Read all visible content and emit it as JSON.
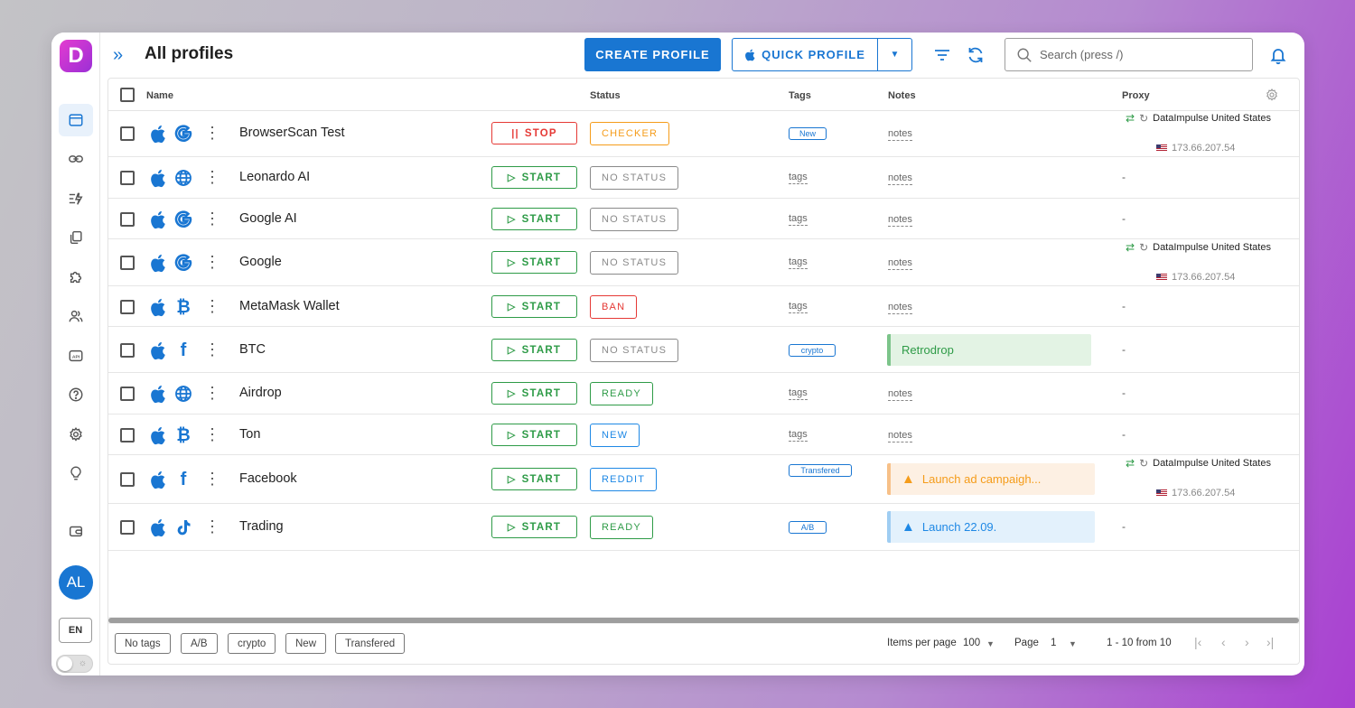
{
  "header": {
    "title": "All profiles",
    "create_label": "CREATE PROFILE",
    "quick_label": "QUICK PROFILE",
    "search_placeholder": "Search (press /)"
  },
  "sidebar": {
    "logo": "D",
    "avatar": "AL",
    "lang": "EN"
  },
  "table": {
    "columns": {
      "name": "Name",
      "status": "Status",
      "tags": "Tags",
      "notes": "Notes",
      "proxy": "Proxy"
    },
    "rows": [
      {
        "name": "BrowserScan Test",
        "site": "google",
        "action": "STOP",
        "status": "CHECKER",
        "tag": "New",
        "note": "notes",
        "note_type": "link",
        "proxy": true
      },
      {
        "name": "Leonardo AI",
        "site": "globe",
        "action": "START",
        "status": "NO STATUS",
        "tag": "tags",
        "note": "notes",
        "note_type": "link",
        "proxy": false
      },
      {
        "name": "Google AI",
        "site": "google",
        "action": "START",
        "status": "NO STATUS",
        "tag": "tags",
        "note": "notes",
        "note_type": "link",
        "proxy": false
      },
      {
        "name": "Google",
        "site": "google",
        "action": "START",
        "status": "NO STATUS",
        "tag": "tags",
        "note": "notes",
        "note_type": "link",
        "proxy": true
      },
      {
        "name": "MetaMask Wallet",
        "site": "bitcoin",
        "action": "START",
        "status": "BAN",
        "tag": "tags",
        "note": "notes",
        "note_type": "link",
        "proxy": false
      },
      {
        "name": "BTC",
        "site": "facebook",
        "action": "START",
        "status": "NO STATUS",
        "tag": "crypto",
        "note": "Retrodrop",
        "note_type": "green",
        "proxy": false
      },
      {
        "name": "Airdrop",
        "site": "globe",
        "action": "START",
        "status": "READY",
        "tag": "tags",
        "note": "notes",
        "note_type": "link",
        "proxy": false
      },
      {
        "name": "Ton",
        "site": "bitcoin",
        "action": "START",
        "status": "NEW",
        "tag": "tags",
        "note": "notes",
        "note_type": "link",
        "proxy": false
      },
      {
        "name": "Facebook",
        "site": "facebook",
        "action": "START",
        "status": "REDDIT",
        "tag": "Transfered",
        "note": "Launch ad campaigh...",
        "note_type": "orange",
        "proxy": true
      },
      {
        "name": "Trading",
        "site": "tiktok",
        "action": "START",
        "status": "READY",
        "tag": "A/B",
        "note": "Launch 22.09.",
        "note_type": "blue",
        "proxy": false
      }
    ],
    "proxy": {
      "name": "DataImpulse United States",
      "ip": "173.66.207.54",
      "empty": "-"
    }
  },
  "status_colors": {
    "CHECKER": "#f59c1a",
    "NO STATUS": "#8a8a8a",
    "BAN": "#e53935",
    "READY": "#2e9b47",
    "NEW": "#1e88e5",
    "REDDIT": "#1e88e5"
  },
  "footer": {
    "chips": [
      "No tags",
      "A/B",
      "crypto",
      "New",
      "Transfered"
    ],
    "items_per_page_label": "Items per page",
    "items_per_page": "100",
    "page_label": "Page",
    "page": "1",
    "range": "1 - 10 from 10"
  }
}
